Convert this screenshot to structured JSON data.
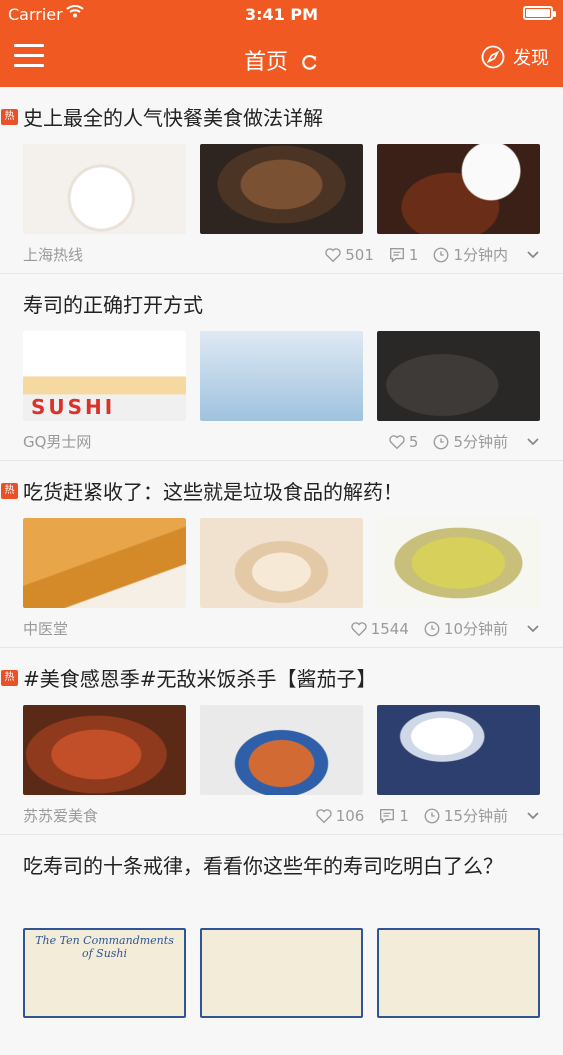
{
  "status_bar": {
    "carrier": "Carrier",
    "time": "3:41 PM"
  },
  "nav": {
    "title": "首页",
    "discover_label": "发现",
    "bar_color": "#f05a22"
  },
  "hot_badge": "热",
  "feed": [
    {
      "hot": true,
      "title": "史上最全的人气快餐美食做法详解",
      "source": "上海热线",
      "likes": "501",
      "comments": "1",
      "time": "1分钟内"
    },
    {
      "hot": false,
      "title": "寿司的正确打开方式",
      "source": "GQ男士网",
      "likes": "5",
      "comments": "",
      "time": "5分钟前"
    },
    {
      "hot": true,
      "title": "吃货赶紧收了：这些就是垃圾食品的解药！",
      "source": "中医堂",
      "likes": "1544",
      "comments": "",
      "time": "10分钟前"
    },
    {
      "hot": true,
      "title": "#美食感恩季#无敌米饭杀手【酱茄子】",
      "source": "苏苏爱美食",
      "likes": "106",
      "comments": "1",
      "time": "15分钟前"
    },
    {
      "hot": false,
      "title": "吃寿司的十条戒律，看看你这些年的寿司吃明白了么？"
    }
  ],
  "thumbnail_text": {
    "sushi_sign": "SUSHI",
    "comic_title": "The Ten Commandments of Sushi"
  },
  "icons": {
    "menu": "hamburger-icon",
    "refresh": "refresh-icon",
    "discover": "compass-icon",
    "like": "heart-icon",
    "comment": "comment-icon",
    "time": "clock-icon",
    "more": "chevron-down-icon"
  }
}
